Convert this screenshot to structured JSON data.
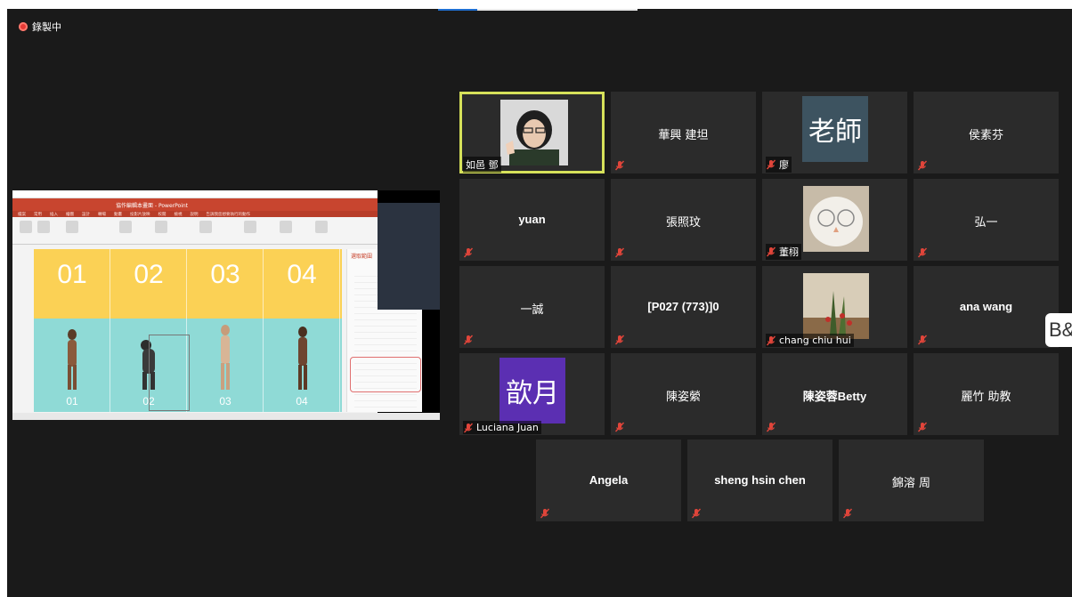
{
  "recording": {
    "label": "錄製中"
  },
  "shared_screen": {
    "app_title": "協作編輯本畫面 - PowerPoint",
    "menu": [
      "檔案",
      "常用",
      "插入",
      "繪圖",
      "設計",
      "轉場",
      "動畫",
      "投影片放映",
      "校閱",
      "檢視",
      "說明",
      "告訴我您想要執行的動作"
    ],
    "slide_numbers": [
      "01",
      "02",
      "03",
      "04"
    ],
    "slide_labels": [
      "01",
      "02",
      "03",
      "04"
    ],
    "side_panel_title": "選取範圍"
  },
  "participants": [
    {
      "name": "如邑 鄧",
      "type": "video",
      "muted": false,
      "active_speaker": true
    },
    {
      "name": "華興 建坦",
      "type": "name",
      "muted": true
    },
    {
      "name": "廖",
      "type": "avatar",
      "avatar_text": "老師",
      "avatar_color": "#3d5360",
      "muted": true
    },
    {
      "name": "侯素芬",
      "type": "name",
      "muted": true
    },
    {
      "name": "yuan",
      "type": "name-bold",
      "muted": true
    },
    {
      "name": "張照玟",
      "type": "name",
      "muted": true
    },
    {
      "name": "董栩",
      "type": "video-photo",
      "muted": true
    },
    {
      "name": "弘一",
      "type": "name",
      "muted": true
    },
    {
      "name": "一誠",
      "type": "name",
      "muted": true
    },
    {
      "name": "[P027 (773)]0",
      "type": "name-bold",
      "muted": true
    },
    {
      "name": "chang chiu hui",
      "type": "photo",
      "muted": true
    },
    {
      "name": "ana wang",
      "type": "name-bold",
      "muted": true
    },
    {
      "name": "Luciana Juan",
      "type": "avatar",
      "avatar_text": "歆月",
      "avatar_color": "#5b2fb2",
      "muted": true
    },
    {
      "name": "陳姿縈",
      "type": "name",
      "muted": true
    },
    {
      "name": "陳姿蓉Betty",
      "type": "name-bold",
      "muted": true
    },
    {
      "name": "麗竹 助教",
      "type": "name",
      "muted": true
    },
    {
      "name": "Angela",
      "type": "name-bold",
      "muted": true
    },
    {
      "name": "sheng hsin chen",
      "type": "name-bold",
      "muted": true
    },
    {
      "name": "錦溶 周",
      "type": "name",
      "muted": true
    }
  ],
  "side_tab": {
    "label": "B&"
  },
  "colors": {
    "active_border": "#d6e15a",
    "mute_icon": "#e0453a",
    "tile_bg": "#2b2b2b"
  }
}
